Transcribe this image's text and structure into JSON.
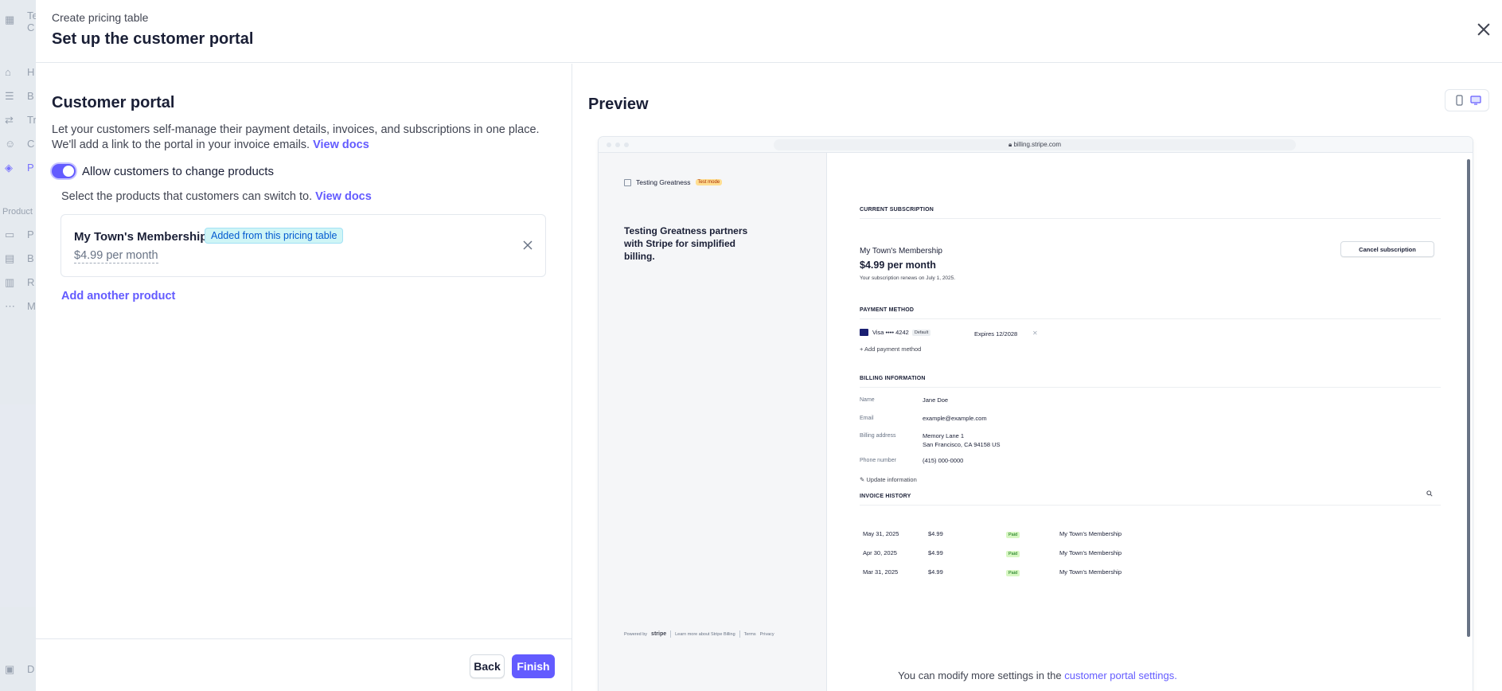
{
  "bg": {
    "items": [
      {
        "label": "Te"
      },
      {
        "label": "C"
      },
      {
        "label": "H"
      },
      {
        "label": "B"
      },
      {
        "label": "Tr"
      },
      {
        "label": "C"
      },
      {
        "label": "P"
      },
      {
        "label": "Product"
      },
      {
        "label": "P"
      },
      {
        "label": "B"
      },
      {
        "label": "R"
      },
      {
        "label": "M"
      },
      {
        "label": "D"
      }
    ]
  },
  "header": {
    "crumb": "Create pricing table",
    "title": "Set up the customer portal"
  },
  "left": {
    "title": "Customer portal",
    "description": "Let your customers self-manage their payment details, invoices, and subscriptions in one place. We'll add a link to the portal in your invoice emails.",
    "view_docs": "View docs",
    "toggle_label": "Allow customers to change products",
    "toggle_on": true,
    "select_text": "Select the products that customers can switch to.",
    "select_link": "View docs",
    "product": {
      "name": "My Town's Membership",
      "badge": "Added from this pricing table",
      "price": "$4.99 per month"
    },
    "add_another": "Add another product"
  },
  "footer": {
    "back": "Back",
    "finish": "Finish"
  },
  "preview": {
    "title": "Preview",
    "url": "billing.stripe.com",
    "business": "Testing Greatness",
    "test_mode": "Test mode",
    "tagline": "Testing Greatness partners with Stripe for simplified billing.",
    "powered_by": "Powered by",
    "stripe": "stripe",
    "learn_more": "Learn more about Stripe Billing",
    "terms": "Terms",
    "privacy": "Privacy",
    "current_sub_heading": "CURRENT SUBSCRIPTION",
    "sub_name": "My Town's Membership",
    "sub_price": "$4.99 per month",
    "renew": "Your subscription renews on July 1, 2025.",
    "cancel": "Cancel subscription",
    "payment_heading": "PAYMENT METHOD",
    "card": "Visa •••• 4242",
    "default": "Default",
    "expires": "Expires 12/2028",
    "add_payment": "+ Add payment method",
    "billing_heading": "BILLING INFORMATION",
    "billing": {
      "name_label": "Name",
      "name": "Jane Doe",
      "email_label": "Email",
      "email": "example@example.com",
      "address_label": "Billing address",
      "address1": "Memory Lane 1",
      "address2": "San Francisco, CA 94158 US",
      "phone_label": "Phone number",
      "phone": "(415) 000-0000"
    },
    "update_info": "Update information",
    "invoice_heading": "INVOICE HISTORY",
    "invoices": [
      {
        "date": "May 31, 2025",
        "amount": "$4.99",
        "status": "Paid",
        "product": "My Town's Membership"
      },
      {
        "date": "Apr 30, 2025",
        "amount": "$4.99",
        "status": "Paid",
        "product": "My Town's Membership"
      },
      {
        "date": "Mar 31, 2025",
        "amount": "$4.99",
        "status": "Paid",
        "product": "My Town's Membership"
      }
    ],
    "note": "You can modify more settings in the",
    "note_link": "customer portal settings."
  },
  "colors": {
    "accent": "#635bff",
    "paid_bg": "#d7f7c2",
    "test_bg": "#ffde92",
    "badge_bg": "#cff5f6"
  }
}
